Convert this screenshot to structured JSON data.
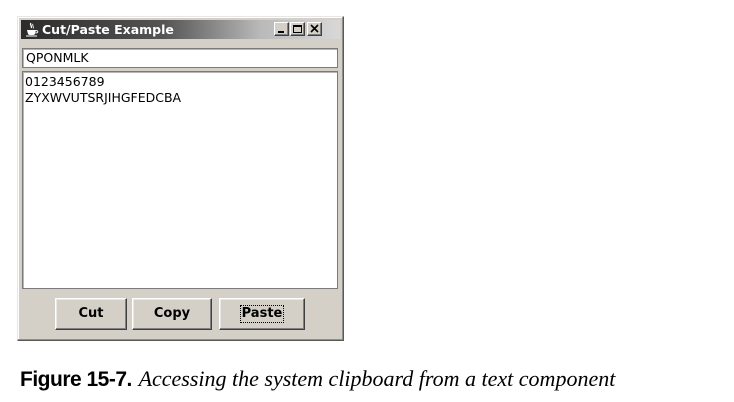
{
  "window": {
    "title": "Cut/Paste Example",
    "icons": {
      "app": "java-cup-icon",
      "minimize": "minimize-icon",
      "maximize": "maximize-icon",
      "close": "close-icon"
    }
  },
  "text_field": {
    "value": "QPONMLK"
  },
  "text_area": {
    "lines": [
      "0123456789",
      "ZYXWVUTSRJIHGFEDCBA"
    ]
  },
  "buttons": {
    "cut": "Cut",
    "copy": "Copy",
    "paste": "Paste"
  },
  "caption": {
    "label": "Figure 15-7.",
    "text": "Accessing the system clipboard from a text component"
  },
  "colors": {
    "window_background": "#d4d0c8",
    "title_gradient_start": "#2b2b2b",
    "title_gradient_end": "#d8d8d8"
  }
}
